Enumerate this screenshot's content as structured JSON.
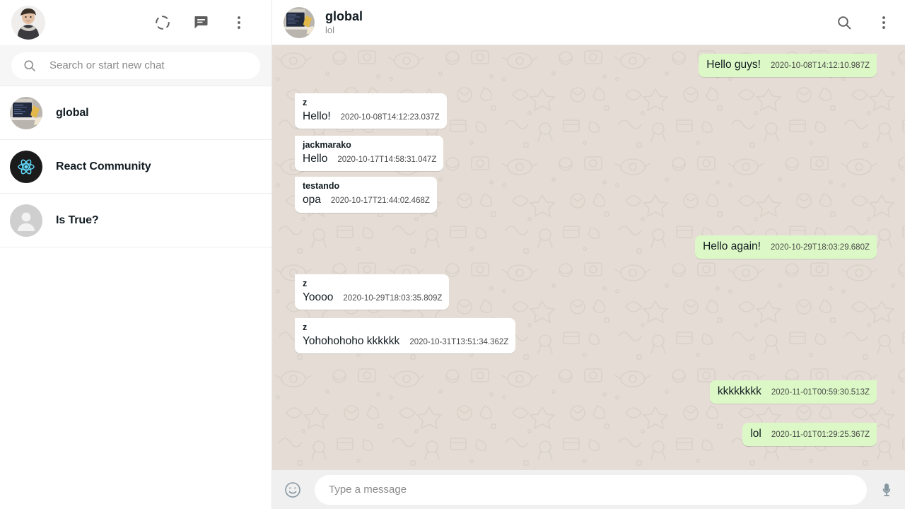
{
  "sidebar": {
    "header": {
      "avatar_name": "user-photo-avatar",
      "status_icon": "status-ring-icon",
      "new_chat_icon": "new-chat-icon",
      "menu_icon": "menu-dots-icon"
    },
    "search": {
      "placeholder": "Search or start new chat",
      "value": "",
      "icon": "search-icon"
    },
    "chats": [
      {
        "name": "global",
        "avatar": "laptop-photo-avatar"
      },
      {
        "name": "React Community",
        "avatar": "react-logo-avatar"
      },
      {
        "name": "Is True?",
        "avatar": "default-person-avatar"
      }
    ]
  },
  "chat": {
    "header": {
      "title": "global",
      "subtitle": "lol",
      "avatar": "laptop-photo-avatar",
      "search_icon": "search-icon",
      "menu_icon": "menu-dots-icon"
    },
    "messages": [
      {
        "direction": "out",
        "author": "",
        "text": "Hello guys!",
        "time": "2020-10-08T14:12:10.987Z"
      },
      {
        "direction": "in",
        "author": "z",
        "text": "Hello!",
        "time": "2020-10-08T14:12:23.037Z"
      },
      {
        "direction": "in",
        "author": "jackmarako",
        "text": "Hello",
        "time": "2020-10-17T14:58:31.047Z"
      },
      {
        "direction": "in",
        "author": "testando",
        "text": "opa",
        "time": "2020-10-17T21:44:02.468Z"
      },
      {
        "direction": "out",
        "author": "",
        "text": "Hello again!",
        "time": "2020-10-29T18:03:29.680Z"
      },
      {
        "direction": "in",
        "author": "z",
        "text": "Yoooo",
        "time": "2020-10-29T18:03:35.809Z"
      },
      {
        "direction": "in",
        "author": "z",
        "text": "Yohohohoho kkkkkk",
        "time": "2020-10-31T13:51:34.362Z"
      },
      {
        "direction": "out",
        "author": "",
        "text": "kkkkkkkk",
        "time": "2020-11-01T00:59:30.513Z"
      },
      {
        "direction": "out",
        "author": "",
        "text": "lol",
        "time": "2020-11-01T01:29:25.367Z"
      }
    ],
    "composer": {
      "emoji_icon": "emoji-smiley-icon",
      "placeholder": "Type a message",
      "value": "",
      "mic_icon": "microphone-icon"
    }
  },
  "colors": {
    "outgoing_bubble": "#dcf8c6",
    "incoming_bubble": "#ffffff",
    "chat_background": "#e5ddd5",
    "composer_background": "#f0f0f0",
    "search_background": "#f6f6f6"
  }
}
